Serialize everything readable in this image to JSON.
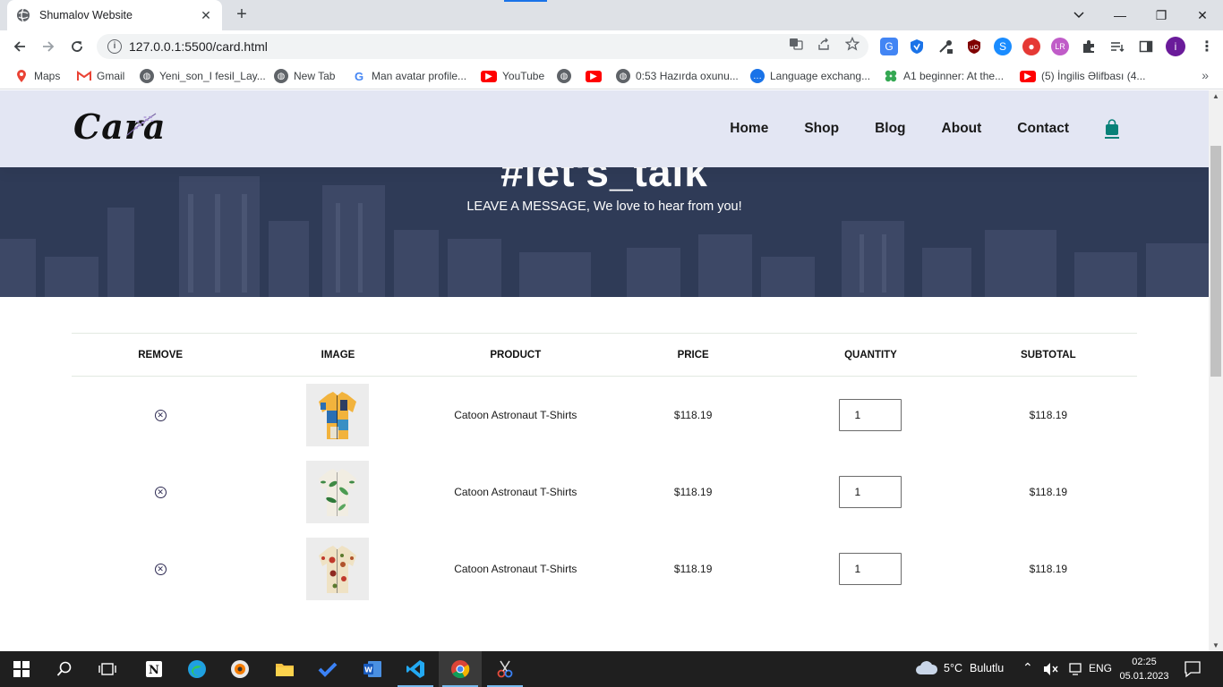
{
  "browser": {
    "tab_title": "Shumalov Website",
    "tab_close": "✕",
    "new_tab": "+",
    "url": "127.0.0.1:5500/card.html",
    "window_controls": {
      "minimize": "—",
      "restore": "❐",
      "close": "✕"
    },
    "bookmarks": [
      {
        "label": "Maps",
        "icon": "maps-pin-icon",
        "color": "#34a853"
      },
      {
        "label": "Gmail",
        "icon": "gmail-icon",
        "color": "#ea4335"
      },
      {
        "label": "Yeni_son_I fesil_Lay...",
        "icon": "globe-icon",
        "color": "#5f6368"
      },
      {
        "label": "New Tab",
        "icon": "globe-icon",
        "color": "#5f6368"
      },
      {
        "label": "Man avatar profile...",
        "icon": "google-icon",
        "color": "#4285f4"
      },
      {
        "label": "YouTube",
        "icon": "youtube-icon",
        "color": "#ff0000"
      },
      {
        "label": "",
        "icon": "globe-icon",
        "color": "#5f6368"
      },
      {
        "label": "",
        "icon": "youtube-icon",
        "color": "#ff0000"
      },
      {
        "label": "0:53 Hazırda oxunu...",
        "icon": "globe-icon",
        "color": "#5f6368"
      },
      {
        "label": "Language exchang...",
        "icon": "chat-icon",
        "color": "#1a73e8"
      },
      {
        "label": "A1 beginner: At the...",
        "icon": "clover-icon",
        "color": "#34a853"
      },
      {
        "label": "(5) İngilis Əlifbası (4...",
        "icon": "youtube-icon",
        "color": "#ff0000"
      }
    ],
    "bookmarks_more": "»",
    "profile_initial": "i"
  },
  "site": {
    "logo": "Cara",
    "nav": [
      "Home",
      "Shop",
      "Blog",
      "About",
      "Contact"
    ],
    "accent_color": "#088178",
    "hero_heading": "#let's_talk",
    "hero_subtitle": "LEAVE A MESSAGE, We love to hear from you!"
  },
  "cart": {
    "columns": [
      "Remove",
      "Image",
      "Product",
      "Price",
      "Quantity",
      "Subtotal"
    ],
    "rows": [
      {
        "product": "Catoon Astronaut T-Shirts",
        "price": "$118.19",
        "quantity": "1",
        "subtotal": "$118.19",
        "image": "shirt-yellow-blue-patchwork"
      },
      {
        "product": "Catoon Astronaut T-Shirts",
        "price": "$118.19",
        "quantity": "1",
        "subtotal": "$118.19",
        "image": "shirt-white-green-leaf"
      },
      {
        "product": "Catoon Astronaut T-Shirts",
        "price": "$118.19",
        "quantity": "1",
        "subtotal": "$118.19",
        "image": "shirt-cream-floral"
      }
    ]
  },
  "taskbar": {
    "weather_temp": "5°C",
    "weather_desc": "Bulutlu",
    "language": "ENG",
    "time": "02:25",
    "date": "05.01.2023"
  }
}
